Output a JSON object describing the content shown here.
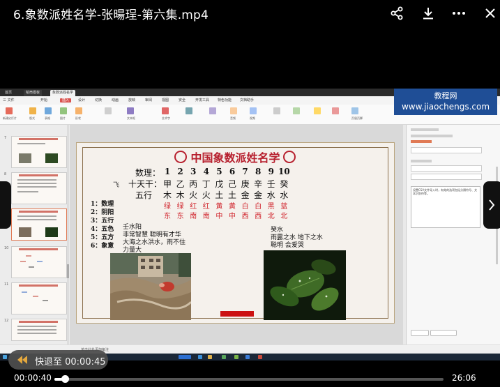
{
  "player": {
    "title": "6.象数派姓名学-张暘珵-第六集.mp4",
    "resume_label": "快退至 00:00:45",
    "current_time": "00:00:40",
    "total_time": "26:06",
    "progress": 0.026
  },
  "app": {
    "tabs": [
      "首页",
      "稻壳模板",
      "象数派姓名学"
    ],
    "menus": [
      "三 文件",
      "开始",
      "插入",
      "设计",
      "切换",
      "动画",
      "放映",
      "审阅",
      "视图",
      "安全",
      "开发工具",
      "特色功能",
      "文档助手"
    ],
    "active_menu": "插入",
    "ribbon_labels": [
      "新建幻灯片",
      "版式",
      "节",
      "表格",
      "图片",
      "形状",
      "图标",
      "文本框",
      "艺术字",
      "符号",
      "公式",
      "音频",
      "视频",
      "超链接",
      "动作",
      "对象",
      "批注",
      "页眉页脚",
      "幻灯片编号"
    ],
    "status_text": "单击此处添加备注",
    "watermark": {
      "line1": "教程网",
      "line2": "www.jiaochengs.com"
    }
  },
  "thumbnails": {
    "numbers": [
      "7",
      "8",
      "9",
      "10",
      "11",
      "12",
      "13"
    ],
    "selected_index": 2
  },
  "slide": {
    "title": "中国象数派姓名学",
    "rows": [
      {
        "label": "数理：",
        "cells": [
          "1",
          "2",
          "3",
          "4",
          "5",
          "6",
          "7",
          "8",
          "9",
          "10"
        ],
        "color": "#111111"
      },
      {
        "label": "十天干：",
        "cells": [
          "甲",
          "乙",
          "丙",
          "丁",
          "戊",
          "己",
          "庚",
          "辛",
          "壬",
          "癸"
        ],
        "color": "#111111"
      },
      {
        "label": "五行",
        "cells": [
          "木",
          "木",
          "火",
          "火",
          "土",
          "土",
          "金",
          "金",
          "水",
          "水"
        ],
        "color": "#111111"
      },
      {
        "label": "",
        "cells": [
          "绿",
          "绿",
          "红",
          "红",
          "黄",
          "黄",
          "白",
          "白",
          "黑",
          "蓝"
        ],
        "color": "#d0232b"
      },
      {
        "label": "",
        "cells": [
          "东",
          "东",
          "南",
          "南",
          "中",
          "中",
          "西",
          "西",
          "北",
          "北"
        ],
        "color": "#d0232b"
      }
    ],
    "legend": [
      "1：数理",
      "2：阴阳",
      "3：五行",
      "4：五色",
      "5：五方",
      "6：象意"
    ],
    "note_left": [
      "壬水阳",
      "非常智慧 聪明有才华",
      "大海之水洪水，雨不住",
      "力量大"
    ],
    "note_right": [
      "癸水",
      "雨露之水 地下之水",
      "聪明 会爱哭"
    ]
  },
  "side_pane": {
    "textarea_text": "设置CSV文件导入时，有效的选项包括分隔符号、文本识别符等。"
  },
  "colors": {
    "accent_red": "#b7202e",
    "wps_red": "#d9534f",
    "watermark_blue": "#1f4e96"
  }
}
